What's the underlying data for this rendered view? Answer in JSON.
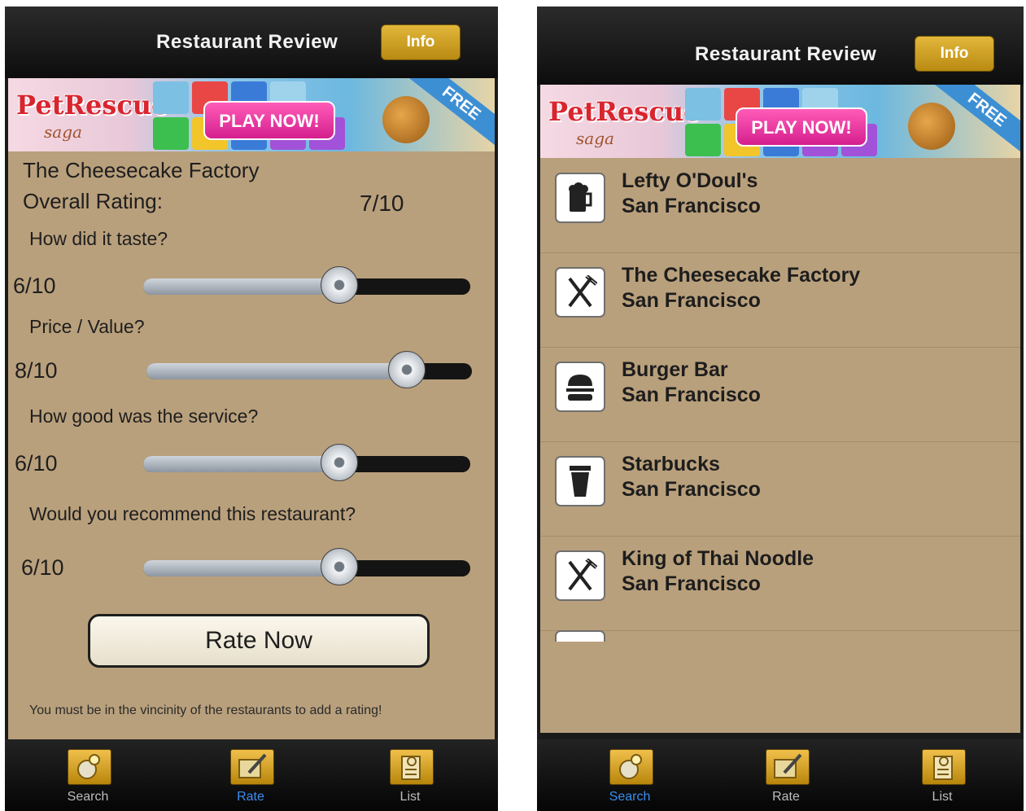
{
  "left_screen": {
    "nav": {
      "title": "Restaurant Review",
      "info_label": "Info"
    },
    "ad": {
      "logo": "PetRescue",
      "logo_sub": "saga",
      "play_label": "PLAY NOW!",
      "free_label": "FREE"
    },
    "restaurant_name": "The Cheesecake Factory",
    "overall_label": "Overall Rating:",
    "overall_value": "7/10",
    "questions": [
      {
        "label": "How did it taste?",
        "value_text": "6/10",
        "value": 6,
        "max": 10
      },
      {
        "label": "Price / Value?",
        "value_text": "8/10",
        "value": 8,
        "max": 10
      },
      {
        "label": "How good was the service?",
        "value_text": "6/10",
        "value": 6,
        "max": 10
      },
      {
        "label": "Would you recommend this restaurant?",
        "value_text": "6/10",
        "value": 6,
        "max": 10
      }
    ],
    "rate_button": "Rate Now",
    "notice": "You must be in the vincinity of the restaurants to add a rating!",
    "tabs": [
      {
        "label": "Search",
        "icon": "search-globe-icon",
        "active": false
      },
      {
        "label": "Rate",
        "icon": "rate-pencil-icon",
        "active": true
      },
      {
        "label": "List",
        "icon": "list-clipboard-icon",
        "active": false
      }
    ]
  },
  "right_screen": {
    "nav": {
      "title": "Restaurant Review",
      "info_label": "Info"
    },
    "ad": {
      "logo": "PetRescue",
      "logo_sub": "saga",
      "play_label": "PLAY NOW!",
      "free_label": "FREE"
    },
    "restaurants": [
      {
        "name": "Lefty O'Doul's",
        "city": "San Francisco",
        "icon": "beer-mug-icon"
      },
      {
        "name": "The Cheesecake Factory",
        "city": "San Francisco",
        "icon": "fork-knife-icon"
      },
      {
        "name": "Burger Bar",
        "city": "San Francisco",
        "icon": "burger-icon"
      },
      {
        "name": "Starbucks",
        "city": "San Francisco",
        "icon": "coffee-cup-icon"
      },
      {
        "name": "King of Thai Noodle",
        "city": "San Francisco",
        "icon": "fork-knife-icon"
      }
    ],
    "tabs": [
      {
        "label": "Search",
        "icon": "search-globe-icon",
        "active": true
      },
      {
        "label": "Rate",
        "icon": "rate-pencil-icon",
        "active": false
      },
      {
        "label": "List",
        "icon": "list-clipboard-icon",
        "active": false
      }
    ]
  },
  "colors": {
    "background": "#b9a07c",
    "accent_gold": "#d4a52a",
    "active_tab": "#3a8ef0"
  }
}
